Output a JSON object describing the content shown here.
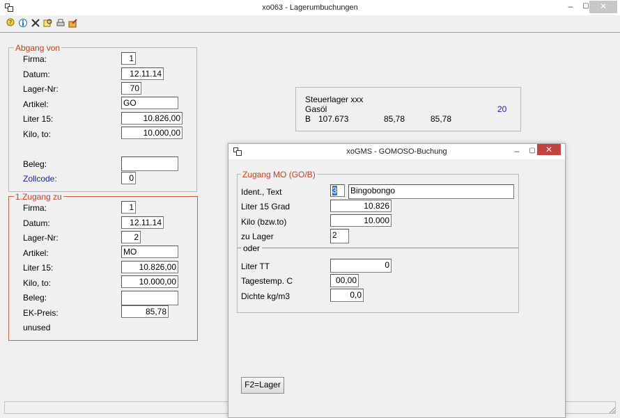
{
  "window": {
    "title": "xo063 - Lagerumbuchungen",
    "min_glyph": "–",
    "max_glyph": "▢",
    "close_glyph": "✕"
  },
  "toolbar": {
    "icons": [
      "help-icon",
      "info-icon",
      "delete-icon",
      "search-icon",
      "print-icon",
      "export-icon"
    ]
  },
  "abgang": {
    "legend": "Abgang von",
    "firma_label": "Firma:",
    "firma": "1",
    "datum_label": "Datum:",
    "datum": "12.11.14",
    "lager_label": "Lager-Nr:",
    "lager": "70",
    "artikel_label": "Artikel:",
    "artikel": "GO",
    "liter_label": "Liter 15:",
    "liter": "10.826,00",
    "kilo_label": "Kilo, to:",
    "kilo": "10.000,00",
    "beleg_label": "Beleg:",
    "beleg": "",
    "zollcode_label": "Zollcode:",
    "zollcode": "0"
  },
  "zugang": {
    "legend": "1.Zugang zu",
    "firma_label": "Firma:",
    "firma": "1",
    "datum_label": "Datum:",
    "datum": "12.11.14",
    "lager_label": "Lager-Nr:",
    "lager": "2",
    "artikel_label": "Artikel:",
    "artikel": "MO",
    "liter_label": "Liter 15:",
    "liter": "10.826,00",
    "kilo_label": "Kilo, to:",
    "kilo": "10.000,00",
    "beleg_label": "Beleg:",
    "beleg": "",
    "ekpreis_label": "EK-Preis:",
    "ekpreis": "85,78",
    "unused_label": "unused"
  },
  "info": {
    "line1": "Steuerlager xxx",
    "line2": "Gasöl",
    "line2_value": "20",
    "line3_a": "B",
    "line3_b": "107.673",
    "line3_c": "85,78",
    "line3_d": "85,78"
  },
  "dialog": {
    "title": "xoGMS - GOMOSO-Buchung",
    "min_glyph": "–",
    "max_glyph": "▢",
    "close_glyph": "✕",
    "legend": "Zugang MO (GO/B)",
    "ident_label": "Ident., Text",
    "ident_value": "3",
    "ident_text": "Bingobongo",
    "liter15_label": "Liter 15 Grad",
    "liter15": "10.826",
    "kilo_label": "Kilo (bzw.to)",
    "kilo": "10.000",
    "zulager_label": "zu Lager",
    "zulager": "2",
    "oder_label": "oder",
    "litertt_label": "Liter TT",
    "litertt": "0",
    "tagestemp_label": "Tagestemp. C",
    "tagestemp": "00,00",
    "dichte_label": "Dichte kg/m3",
    "dichte": "0,0",
    "f2_button": "F2=Lager"
  }
}
